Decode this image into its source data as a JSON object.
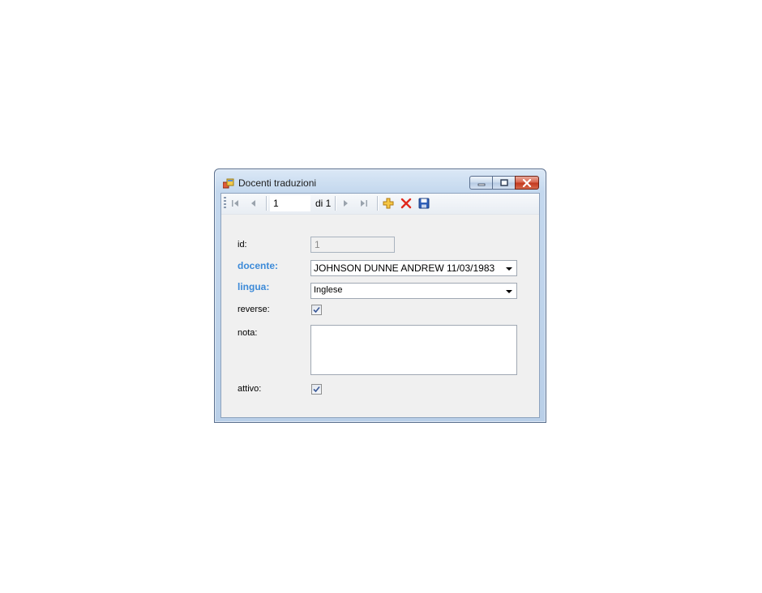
{
  "window": {
    "title": "Docenti traduzioni"
  },
  "navigator": {
    "position": "1",
    "count_label": "di 1"
  },
  "form": {
    "id_label": "id:",
    "id_value": "1",
    "docente_label": "docente:",
    "docente_value": "JOHNSON DUNNE ANDREW 11/03/1983",
    "lingua_label": "lingua:",
    "lingua_value": "Inglese",
    "reverse_label": "reverse:",
    "reverse_checked": true,
    "nota_label": "nota:",
    "nota_value": "",
    "attivo_label": "attivo:",
    "attivo_checked": true
  },
  "colors": {
    "required_label": "#3c8ad8",
    "close_button": "#c2361c"
  },
  "icons": {
    "first": "move-first-icon",
    "previous": "move-previous-icon",
    "next": "move-next-icon",
    "last": "move-last-icon",
    "add": "add-new-icon",
    "delete": "delete-icon",
    "save": "save-icon"
  }
}
